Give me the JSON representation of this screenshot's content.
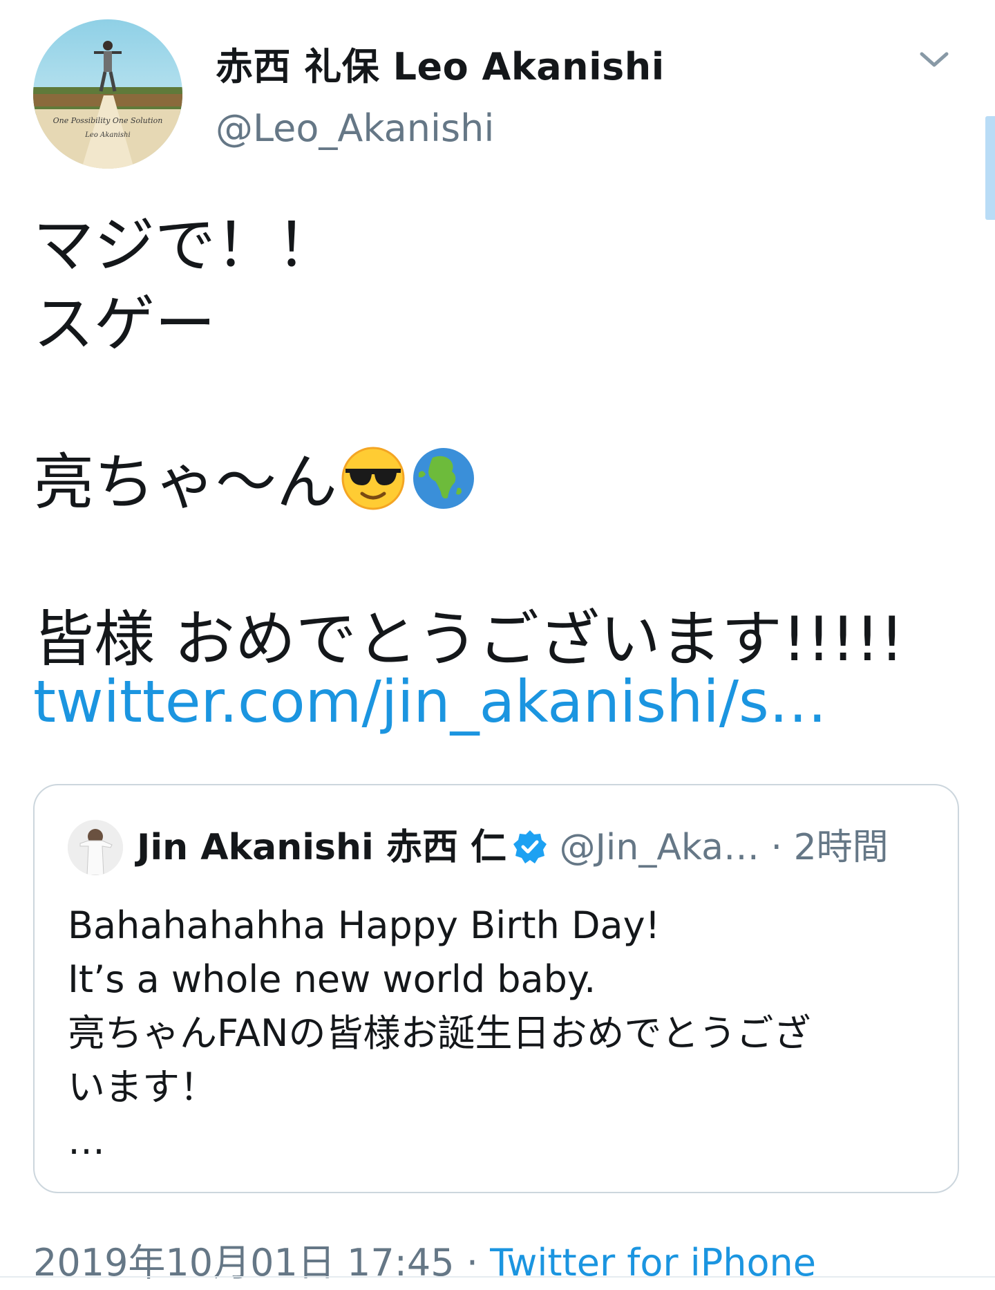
{
  "author": {
    "display_name": "赤西 礼保 Leo Akanishi",
    "handle": "@Leo_Akanishi",
    "avatar_caption_line1": "One Possibility One Solution",
    "avatar_caption_line2": "Leo Akanishi"
  },
  "tweet": {
    "lines": [
      "マジで！！",
      "スゲー",
      "",
      "亮ちゃ〜ん",
      "",
      "皆様 おめでとうございます!!!!!"
    ],
    "emojis": [
      "sunglasses-face-icon",
      "globe-africa-icon"
    ],
    "link": "twitter.com/jin_akanishi/s…"
  },
  "quoted_tweet": {
    "name": "Jin Akanishi  赤西 仁",
    "verified": true,
    "handle": "@Jin_Aka…",
    "separator": "·",
    "time": "2時間",
    "body_lines": [
      "Bahahahahha Happy Birth Day!",
      "It’s a whole new world baby.",
      "亮ちゃんFANの皆様お誕生日おめでとうござ",
      "います！",
      "…"
    ]
  },
  "meta": {
    "timestamp": "2019年10月01日 17:45",
    "separator": "·",
    "source": "Twitter for iPhone"
  },
  "colors": {
    "link": "#1b95e0",
    "secondary_text": "#657786",
    "border": "#ccd6dd",
    "verified": "#1da1f2"
  }
}
